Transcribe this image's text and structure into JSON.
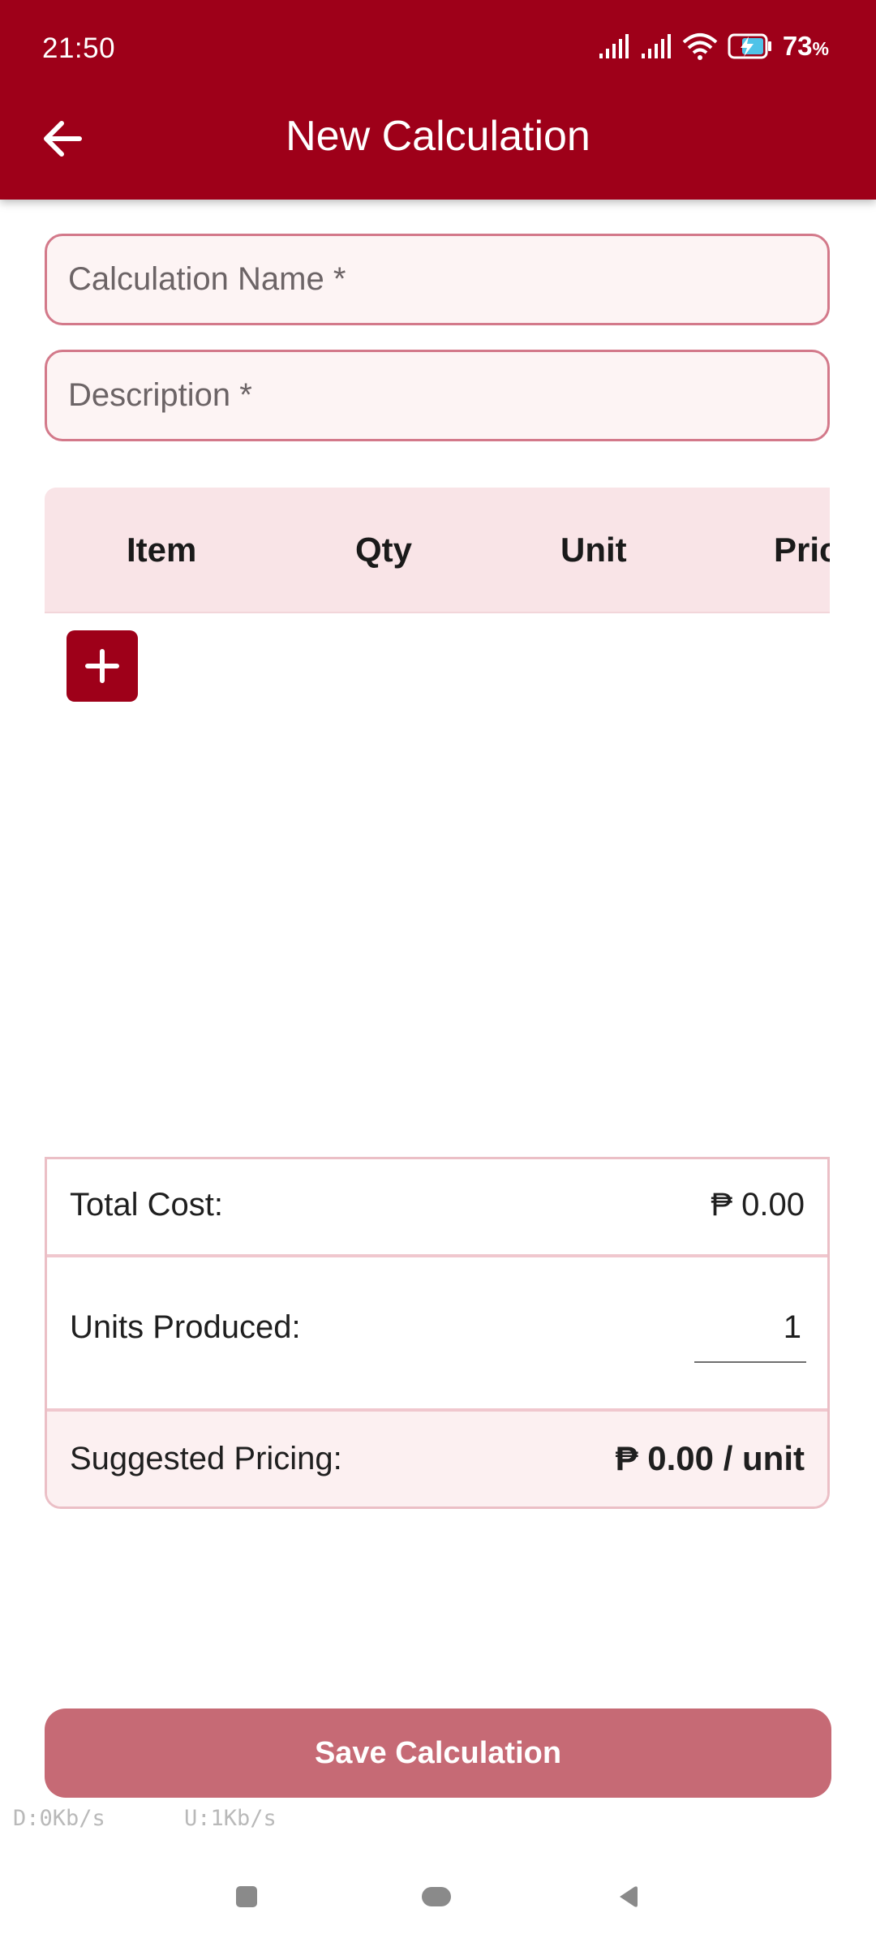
{
  "status_bar": {
    "time": "21:50",
    "battery_percent": "73",
    "battery_unit": "%"
  },
  "app_bar": {
    "title": "New Calculation",
    "back_icon": "arrow-left-icon"
  },
  "form": {
    "name_placeholder": "Calculation Name *",
    "name_value": "",
    "description_placeholder": "Description *",
    "description_value": ""
  },
  "items_table": {
    "columns": [
      "Item",
      "Qty",
      "Unit",
      "Pric"
    ],
    "rows": [],
    "add_icon": "plus-icon"
  },
  "summary": {
    "total_cost_label": "Total Cost:",
    "total_cost_value": "₱ 0.00",
    "units_produced_label": "Units Produced:",
    "units_produced_value": "1",
    "suggested_pricing_label": "Suggested Pricing:",
    "suggested_pricing_value": "₱ 0.00 / unit"
  },
  "save_button": {
    "label": "Save Calculation"
  },
  "net_speed": {
    "download": "D:0Kb/s",
    "upload": "U:1Kb/s"
  },
  "colors": {
    "primary": "#9e0019",
    "save_button": "#c66a75",
    "field_border": "#d3798a",
    "field_background": "#fdf4f4",
    "table_header": "#f9e4e7"
  }
}
